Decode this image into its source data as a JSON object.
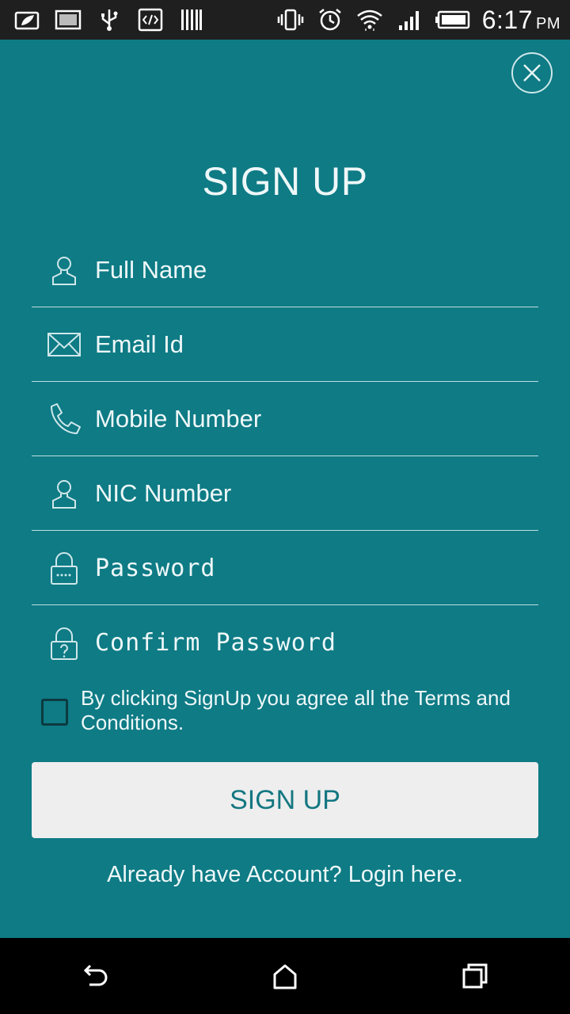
{
  "status_bar": {
    "left_icons": [
      "leaf-notification-icon",
      "image-notification-icon",
      "usb-icon",
      "code-icon",
      "barcode-icon"
    ],
    "right_icons": [
      "vibrate-icon",
      "alarm-icon",
      "wifi-icon",
      "signal-icon",
      "battery-icon"
    ],
    "time": "6:17",
    "ampm": "PM"
  },
  "title": "SIGN UP",
  "fields": {
    "full_name": "Full Name",
    "email": "Email Id",
    "mobile": "Mobile Number",
    "nic": "NIC Number",
    "password": "Password",
    "confirm_password": "Confirm Password"
  },
  "terms": {
    "text": "By clicking SignUp you agree all the Terms and Conditions.",
    "checked": false
  },
  "signup_button": "SIGN UP",
  "login_link": "Already have Account? Login here.",
  "colors": {
    "background": "#0e7b85",
    "button_bg": "#eeeeee",
    "button_text": "#137781"
  },
  "nav": [
    "back-icon",
    "home-icon",
    "recents-icon"
  ]
}
